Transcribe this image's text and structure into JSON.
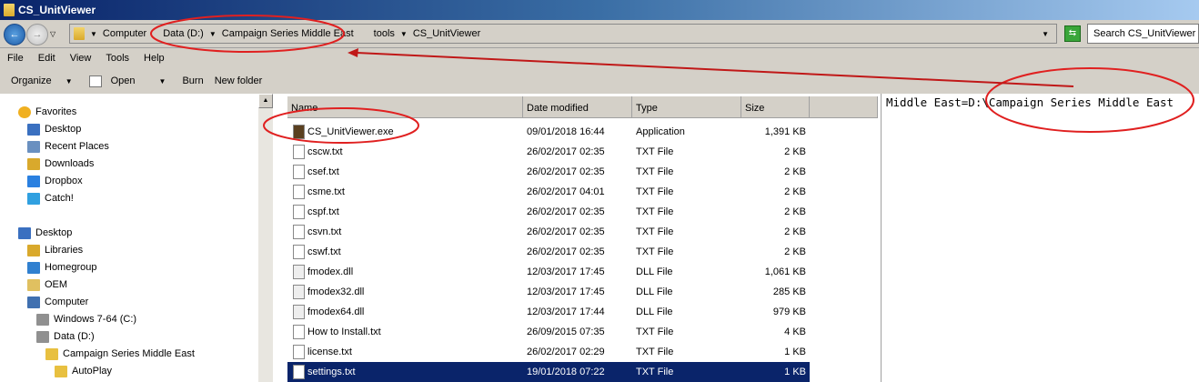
{
  "window": {
    "title": "CS_UnitViewer"
  },
  "address": {
    "crumbs": [
      "Computer",
      "Data (D:)",
      "Campaign Series Middle East",
      "tools",
      "CS_UnitViewer"
    ]
  },
  "search": {
    "placeholder": "Search CS_UnitViewer"
  },
  "menu": [
    "File",
    "Edit",
    "View",
    "Tools",
    "Help"
  ],
  "toolbar": {
    "organize": "Organize",
    "open": "Open",
    "burn": "Burn",
    "new_folder": "New folder"
  },
  "nav": [
    {
      "label": "Favorites",
      "icon": "star-icon",
      "indent": 0
    },
    {
      "label": "Desktop",
      "icon": "desktop-icon",
      "indent": 1
    },
    {
      "label": "Recent Places",
      "icon": "recent-places-icon",
      "indent": 1
    },
    {
      "label": "Downloads",
      "icon": "downloads-icon",
      "indent": 1
    },
    {
      "label": "Dropbox",
      "icon": "dropbox-icon",
      "indent": 1
    },
    {
      "label": "Catch!",
      "icon": "catch-icon",
      "indent": 1
    },
    {
      "label": "Desktop",
      "icon": "desktop-icon",
      "indent": 0
    },
    {
      "label": "Libraries",
      "icon": "libraries-icon",
      "indent": 1
    },
    {
      "label": "Homegroup",
      "icon": "homegroup-icon",
      "indent": 1
    },
    {
      "label": "OEM",
      "icon": "user-folder-icon",
      "indent": 1
    },
    {
      "label": "Computer",
      "icon": "computer-icon",
      "indent": 1
    },
    {
      "label": "Windows 7-64 (C:)",
      "icon": "drive-icon",
      "indent": 2
    },
    {
      "label": "Data (D:)",
      "icon": "drive-icon",
      "indent": 2
    },
    {
      "label": "Campaign Series Middle East",
      "icon": "folder-icon",
      "indent": 3
    },
    {
      "label": "AutoPlay",
      "icon": "folder-icon",
      "indent": 4
    }
  ],
  "columns": [
    "Name",
    "Date modified",
    "Type",
    "Size"
  ],
  "files": [
    {
      "name": "CS_UnitViewer.exe",
      "date": "09/01/2018 16:44",
      "type": "Application",
      "size": "1,391 KB",
      "kind": "exe"
    },
    {
      "name": "cscw.txt",
      "date": "26/02/2017 02:35",
      "type": "TXT File",
      "size": "2 KB",
      "kind": "txt"
    },
    {
      "name": "csef.txt",
      "date": "26/02/2017 02:35",
      "type": "TXT File",
      "size": "2 KB",
      "kind": "txt"
    },
    {
      "name": "csme.txt",
      "date": "26/02/2017 04:01",
      "type": "TXT File",
      "size": "2 KB",
      "kind": "txt"
    },
    {
      "name": "cspf.txt",
      "date": "26/02/2017 02:35",
      "type": "TXT File",
      "size": "2 KB",
      "kind": "txt"
    },
    {
      "name": "csvn.txt",
      "date": "26/02/2017 02:35",
      "type": "TXT File",
      "size": "2 KB",
      "kind": "txt"
    },
    {
      "name": "cswf.txt",
      "date": "26/02/2017 02:35",
      "type": "TXT File",
      "size": "2 KB",
      "kind": "txt"
    },
    {
      "name": "fmodex.dll",
      "date": "12/03/2017 17:45",
      "type": "DLL File",
      "size": "1,061 KB",
      "kind": "dll"
    },
    {
      "name": "fmodex32.dll",
      "date": "12/03/2017 17:45",
      "type": "DLL File",
      "size": "285 KB",
      "kind": "dll"
    },
    {
      "name": "fmodex64.dll",
      "date": "12/03/2017 17:44",
      "type": "DLL File",
      "size": "979 KB",
      "kind": "dll"
    },
    {
      "name": "How to Install.txt",
      "date": "26/09/2015 07:35",
      "type": "TXT File",
      "size": "4 KB",
      "kind": "txt"
    },
    {
      "name": "license.txt",
      "date": "26/02/2017 02:29",
      "type": "TXT File",
      "size": "1 KB",
      "kind": "txt"
    },
    {
      "name": "settings.txt",
      "date": "19/01/2018 07:22",
      "type": "TXT File",
      "size": "1 KB",
      "kind": "txt",
      "selected": true
    }
  ],
  "preview": {
    "text": "Middle East=D:\\Campaign Series Middle East"
  },
  "colors": {
    "annotation": "#e02020",
    "selection": "#0a246a"
  }
}
